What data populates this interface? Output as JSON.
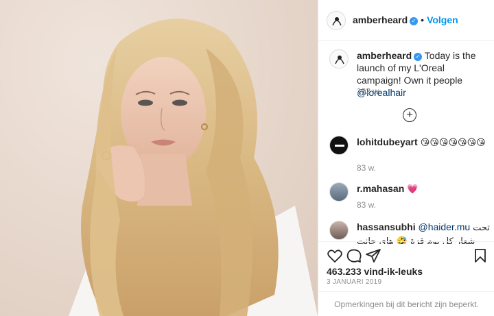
{
  "post": {
    "author": {
      "username": "amberheard",
      "verified_icon": "verified-badge-icon",
      "separator": "•",
      "follow_label": "Volgen"
    },
    "caption": {
      "username": "amberheard",
      "text": " Today is the launch of my L'Oreal campaign! Own it people ",
      "mention": "@lorealhair",
      "age": "102 w."
    },
    "load_more_icon": "plus-circle-icon",
    "comments": [
      {
        "username": "lohitdubeyart",
        "text": " 😘😘😘😘😘😘😘",
        "age": "83 w."
      },
      {
        "username": "r.mahasan",
        "text": " 💗",
        "age": "83 w."
      },
      {
        "username": "hassansubhi",
        "mention": "@haider.mu",
        "text": " تحت شعار كل يوم قزة 🤣 هاي جانت مرة جوني ديب"
      }
    ],
    "actions": {
      "like_icon": "heart-icon",
      "comment_icon": "comment-icon",
      "share_icon": "share-icon",
      "save_icon": "bookmark-icon"
    },
    "likes": "463.233 vind-ik-leuks",
    "date": "3 JANUARI 2019",
    "comments_restricted": "Opmerkingen bij dit bericht zijn beperkt."
  },
  "colors": {
    "link_blue": "#0095f6",
    "mention_blue": "#00376b",
    "secondary_text": "#8e8e8e",
    "heart_pink": "#e75480"
  }
}
